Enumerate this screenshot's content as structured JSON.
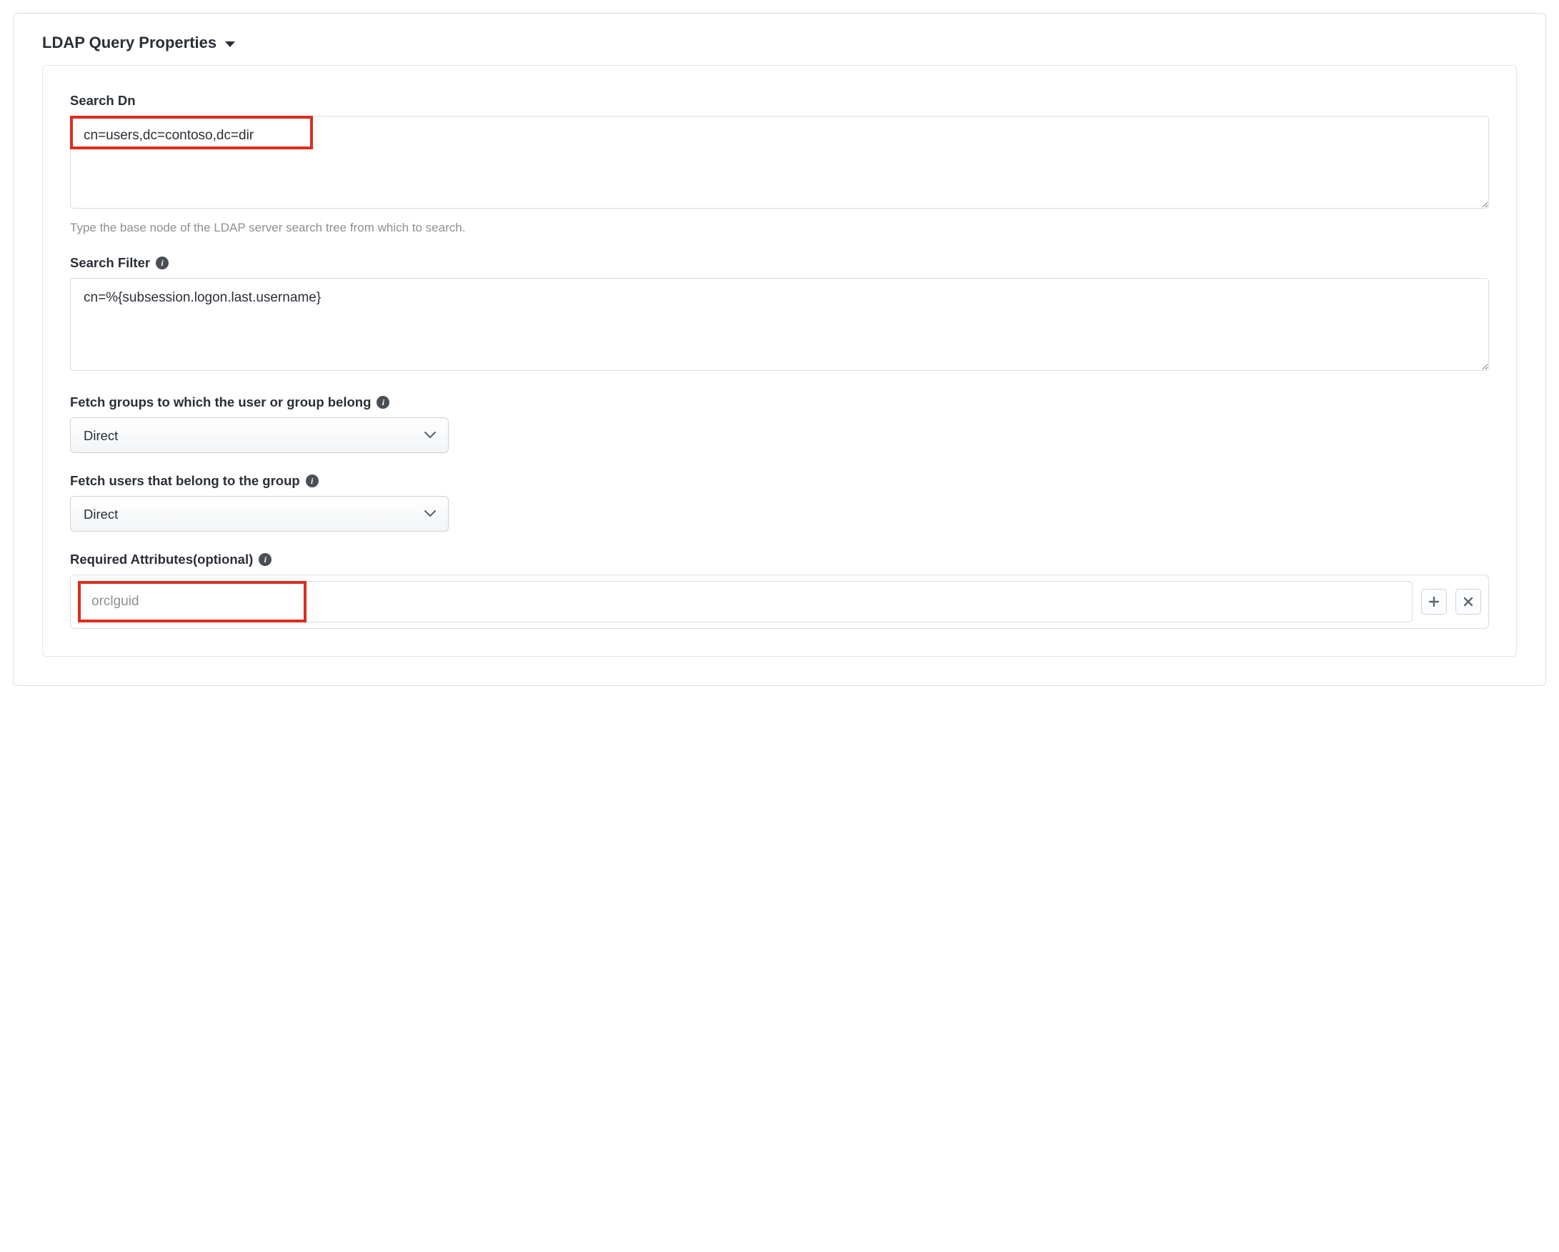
{
  "section": {
    "title": "LDAP Query Properties"
  },
  "fields": {
    "searchDn": {
      "label": "Search Dn",
      "value": "cn=users,dc=contoso,dc=dir",
      "helper": "Type the base node of the LDAP server search tree from which to search."
    },
    "searchFilter": {
      "label": "Search Filter",
      "value": "cn=%{subsession.logon.last.username}"
    },
    "fetchGroups": {
      "label": "Fetch groups to which the user or group belong",
      "value": "Direct"
    },
    "fetchUsers": {
      "label": "Fetch users that belong to the group",
      "value": "Direct"
    },
    "requiredAttrs": {
      "label": "Required Attributes(optional)",
      "placeholder": "orclguid"
    }
  },
  "icons": {
    "info": "i"
  }
}
